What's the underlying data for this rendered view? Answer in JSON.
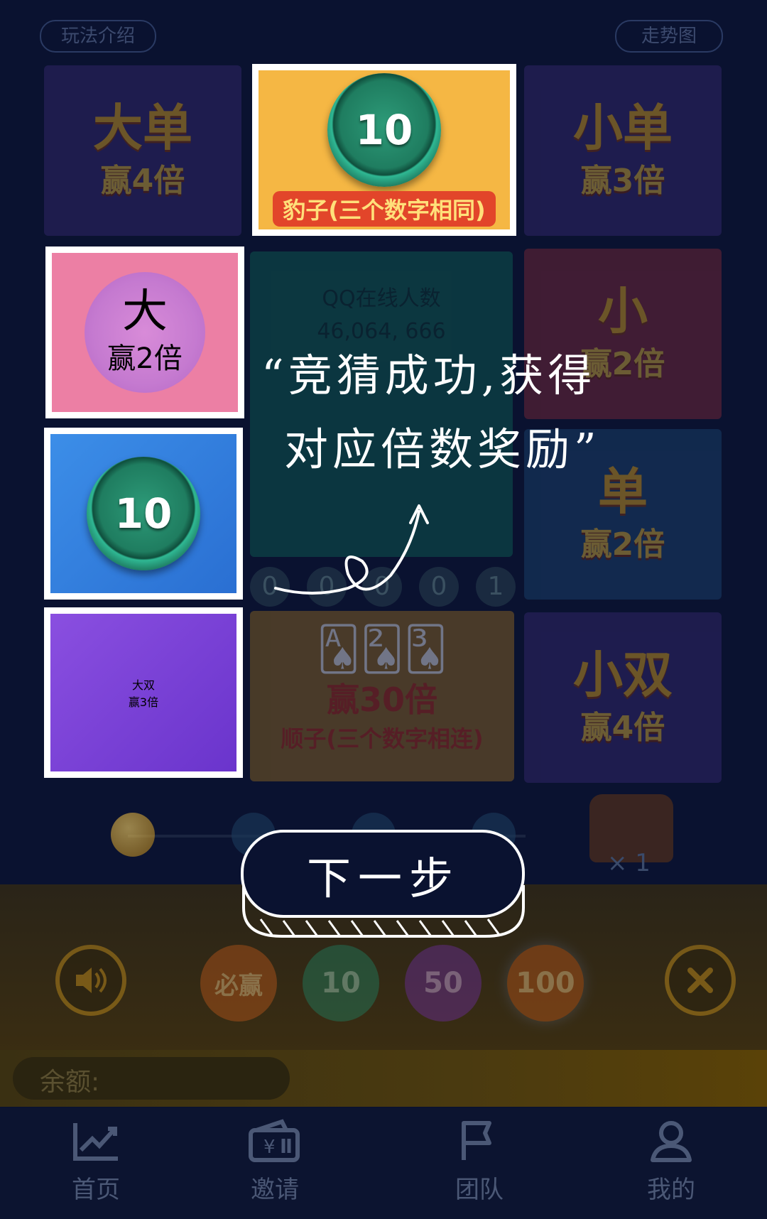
{
  "header": {
    "rules_label": "玩法介绍",
    "trend_label": "走势图"
  },
  "cells": {
    "big_odd": {
      "title": "大单",
      "payout": "赢4倍"
    },
    "triple": {
      "chip_value": "10",
      "caption": "豹子(三个数字相同)"
    },
    "small_odd": {
      "title": "小单",
      "payout": "赢3倍"
    },
    "big": {
      "title": "大",
      "payout": "赢2倍"
    },
    "center": {
      "title": "QQ在线人数",
      "value": "46,064, 666"
    },
    "small": {
      "title": "小",
      "payout": "赢2倍"
    },
    "chip_cell": {
      "chip_value": "10"
    },
    "odd": {
      "title": "单",
      "payout": "赢2倍"
    },
    "big_even": {
      "title": "大双",
      "payout": "赢3倍"
    },
    "straight": {
      "payout": "赢30倍",
      "caption": "顺子(三个数字相连)"
    },
    "small_even": {
      "title": "小双",
      "payout": "赢4倍"
    }
  },
  "digits": [
    "0",
    "0",
    "0",
    "0",
    "1"
  ],
  "treasure": {
    "count": "× 1"
  },
  "chips": [
    {
      "label": "必赢",
      "color": "#b8561a"
    },
    {
      "label": "10",
      "color": "#1f7d60"
    },
    {
      "label": "50",
      "color": "#6a2d9a"
    },
    {
      "label": "100",
      "color": "#b8561a"
    }
  ],
  "balance": {
    "label": "余额:"
  },
  "tabs": [
    {
      "label": "首页",
      "icon": "chart-icon"
    },
    {
      "label": "邀请",
      "icon": "wallet-icon"
    },
    {
      "label": "团队",
      "icon": "flag-icon"
    },
    {
      "label": "我的",
      "icon": "user-icon"
    }
  ],
  "tutorial": {
    "line1": "“竞猜成功,获得",
    "line2": "对应倍数奖励”",
    "next_label": "下一步"
  }
}
